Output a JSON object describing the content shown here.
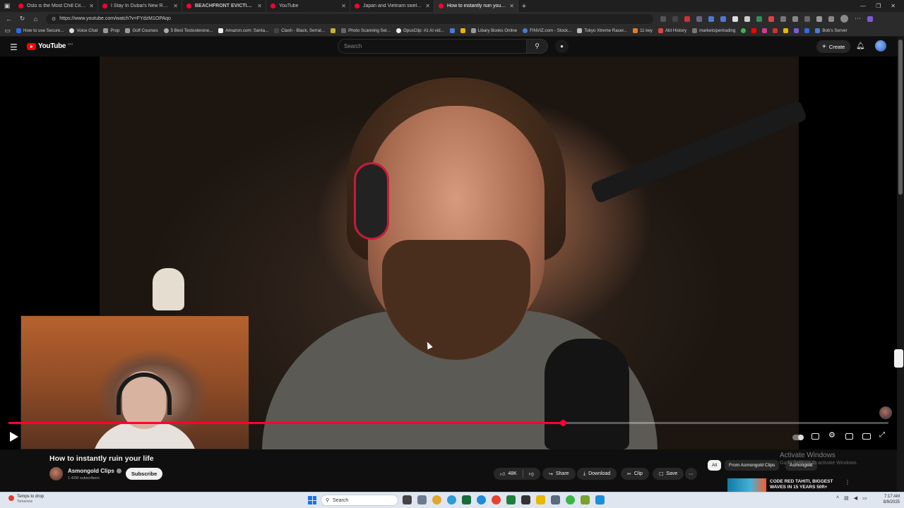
{
  "browser": {
    "tabs": [
      {
        "title": "Oslo is the Most Chill City on Earth",
        "active": false
      },
      {
        "title": "I Stay In Dubai's New Record-Breaking",
        "active": false
      },
      {
        "title": "BEACHFRONT EVICTION: Rangers",
        "active": false
      },
      {
        "title": "YouTube",
        "active": false
      },
      {
        "title": "Japan and Vietnam swelter in record",
        "active": false
      },
      {
        "title": "How to instantly ruin your life - YouTube",
        "active": true
      }
    ],
    "new_tab_label": "+",
    "url": "https://www.youtube.com/watch?v=FYdzM1OPAqo",
    "bookmarks": [
      "How to use Secure...",
      "Voice Chat",
      "Prop",
      "Golf Courses",
      "5 Best Testosterone...",
      "Amazon.com: Santa...",
      "Clash - Black, Serrat...",
      "Photo Scanning Ser...",
      "OpusClip: #1 AI vid...",
      "Libary Books Online",
      "FINVIZ.com - Stock...",
      "Tokyo Xtreme Racer...",
      "11 key",
      "Abt History",
      "marketcipertrading"
    ],
    "bookmark_right": "Bob's Server"
  },
  "masthead": {
    "logo_text": "YouTube",
    "logo_country": "CH",
    "search_placeholder": "Search",
    "create_label": "Create"
  },
  "player": {
    "progress": 0.63,
    "state": "paused"
  },
  "video": {
    "title": "How to instantly ruin your life",
    "channel": "Asmongold Clips",
    "subscribers": "1.42M subscribers",
    "subscribe_label": "Subscribe",
    "likes": "48K",
    "share_label": "Share",
    "download_label": "Download",
    "clip_label": "Clip",
    "save_label": "Save"
  },
  "chips": [
    "All",
    "From Asmongold Clips",
    "Asmongold"
  ],
  "windows_watermark": {
    "line1": "Activate Windows",
    "line2": "Go to Settings to activate Windows."
  },
  "recommended": {
    "title": "CODE RED TAHITI, BIGGEST WAVES IN 15 YEARS 50ft+"
  },
  "taskbar": {
    "weather_main": "Temps to drop",
    "weather_sub": "Tomorrow",
    "search_label": "Search",
    "time": "7:17 AM",
    "date": "8/9/2025"
  },
  "colors": {
    "youtube_red": "#ff0000",
    "progress_red": "#ff0033",
    "page_bg": "#0f0f0f"
  }
}
